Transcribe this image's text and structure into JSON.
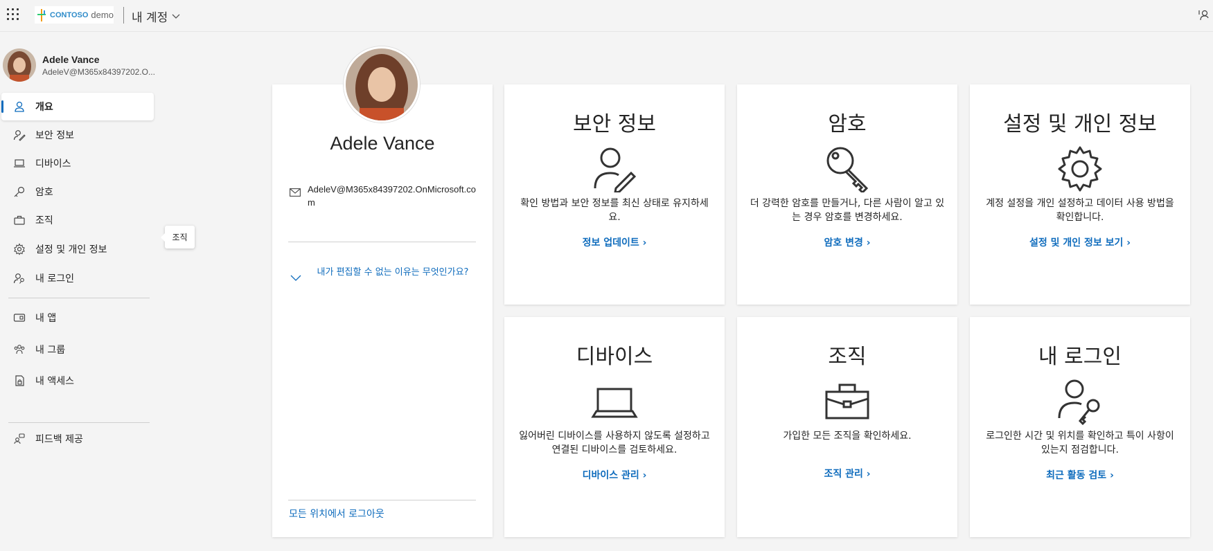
{
  "topbar": {
    "brand_main": "CONTOSO",
    "brand_sub": "demo",
    "app_title": "내 계정"
  },
  "user": {
    "name": "Adele Vance",
    "email_short": "AdeleV@M365x84397202.O...",
    "email_full": "AdeleV@M365x84397202.OnMicrosoft.com"
  },
  "nav": {
    "items": [
      {
        "label": "개요",
        "icon": "person-icon"
      },
      {
        "label": "보안 정보",
        "icon": "person-edit-icon"
      },
      {
        "label": "디바이스",
        "icon": "laptop-icon"
      },
      {
        "label": "암호",
        "icon": "key-icon"
      },
      {
        "label": "조직",
        "icon": "briefcase-icon"
      },
      {
        "label": "설정 및 개인 정보",
        "icon": "gear-icon"
      },
      {
        "label": "내 로그인",
        "icon": "person-key-icon"
      },
      {
        "label": "내 앱",
        "icon": "apps-icon"
      },
      {
        "label": "내 그룹",
        "icon": "people-icon"
      },
      {
        "label": "내 액세스",
        "icon": "lock-doc-icon"
      },
      {
        "label": "피드백 제공",
        "icon": "feedback-icon"
      }
    ],
    "tooltip": "조직"
  },
  "profile_card": {
    "why_link": "내가 편집할 수 없는 이유는 무엇인가요?",
    "signout": "모든 위치에서 로그아웃"
  },
  "tiles": [
    {
      "title": "보안 정보",
      "desc": "확인 방법과 보안 정보를 최신 상태로 유지하세요.",
      "link": "정보 업데이트"
    },
    {
      "title": "암호",
      "desc": "더 강력한 암호를 만들거나, 다른 사람이 알고 있는 경우 암호를 변경하세요.",
      "link": "암호 변경"
    },
    {
      "title": "설정 및 개인 정보",
      "desc": "계정 설정을 개인 설정하고 데이터 사용 방법을 확인합니다.",
      "link": "설정 및 개인 정보 보기"
    },
    {
      "title": "디바이스",
      "desc": "잃어버린 디바이스를 사용하지 않도록 설정하고 연결된 디바이스를 검토하세요.",
      "link": "디바이스 관리"
    },
    {
      "title": "조직",
      "desc": "가입한 모든 조직을 확인하세요.",
      "link": "조직 관리"
    },
    {
      "title": "내 로그인",
      "desc": "로그인한 시간 및 위치를 확인하고 특이 사항이 있는지 점검합니다.",
      "link": "최근 활동 검토"
    }
  ],
  "colors": {
    "accent": "#0f6cbd",
    "background": "#f4f4f4",
    "brand": "#2e8bc9"
  }
}
